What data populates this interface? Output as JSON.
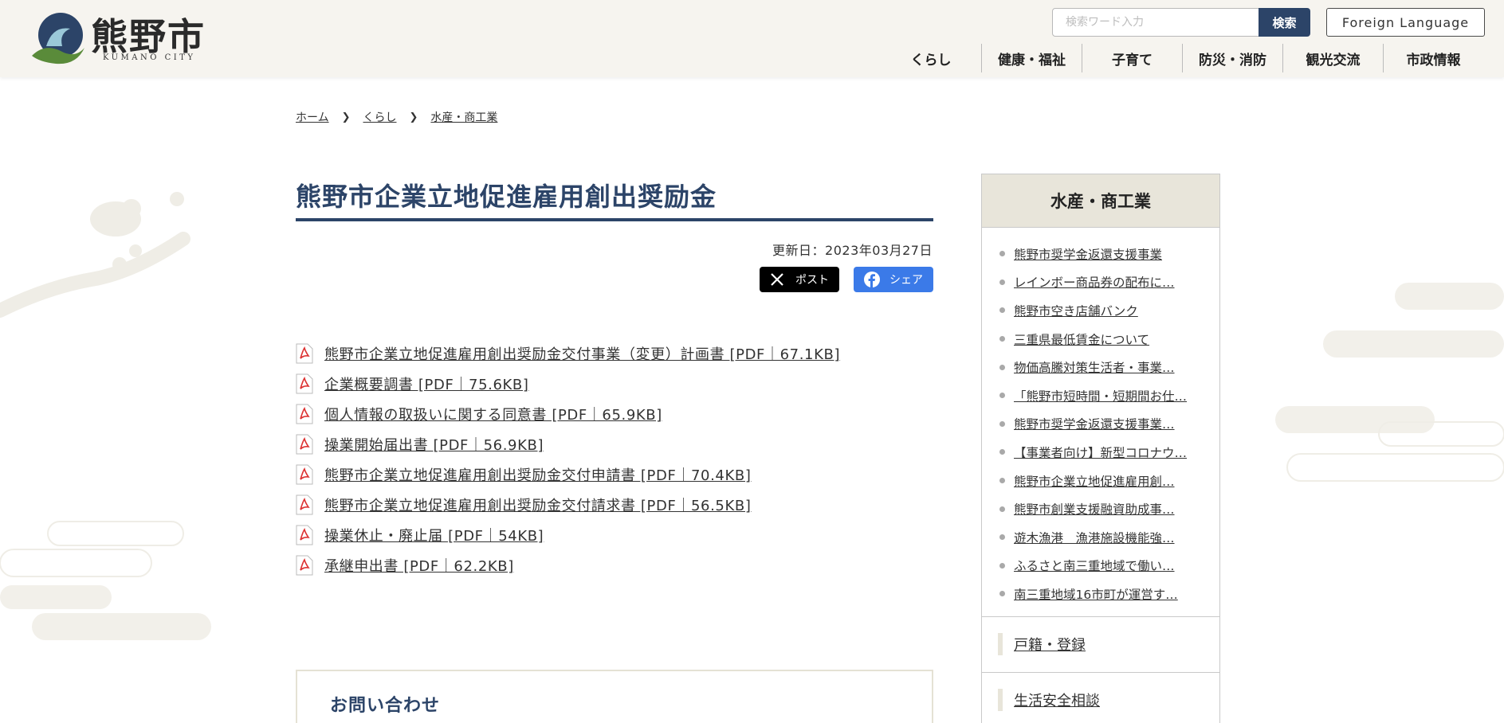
{
  "header": {
    "logo_text": "熊野市",
    "logo_sub": "KUMANO CITY",
    "search_placeholder": "検索ワード入力",
    "search_button": "検索",
    "foreign_button": "Foreign Language",
    "nav": [
      "くらし",
      "健康・福祉",
      "子育て",
      "防災・消防",
      "観光交流",
      "市政情報"
    ]
  },
  "breadcrumb": [
    "ホーム",
    "くらし",
    "水産・商工業"
  ],
  "main": {
    "title": "熊野市企業立地促進雇用創出奨励金",
    "updated": "更新日：2023年03月27日",
    "x_label": "ポスト",
    "fb_label": "シェア",
    "files": [
      "熊野市企業立地促進雇用創出奨励金交付事業（変更）計画書 [PDF｜67.1KB]",
      "企業概要調書 [PDF｜75.6KB]",
      "個人情報の取扱いに関する同意書 [PDF｜65.9KB]",
      "操業開始届出書 [PDF｜56.9KB]",
      "熊野市企業立地促進雇用創出奨励金交付申請書 [PDF｜70.4KB]",
      "熊野市企業立地促進雇用創出奨励金交付請求書 [PDF｜56.5KB]",
      "操業休止・廃止届 [PDF｜54KB]",
      "承継申出書 [PDF｜62.2KB]"
    ],
    "contact_title": "お問い合わせ"
  },
  "sidebar": {
    "title": "水産・商工業",
    "items": [
      "熊野市奨学金返還支援事業",
      "レインボー商品券の配布に…",
      "熊野市空き店舗バンク",
      "三重県最低賃金について",
      "物価高騰対策生活者・事業…",
      "「熊野市短時間・短期間お仕…",
      "熊野市奨学金返還支援事業…",
      "【事業者向け】新型コロナウ…",
      "熊野市企業立地促進雇用創…",
      "熊野市創業支援融資助成事…",
      "遊木漁港　漁港施設機能強…",
      "ふるさと南三重地域で働い…",
      "南三重地域16市町が運営す…"
    ],
    "categories": [
      "戸籍・登録",
      "生活安全相談"
    ]
  },
  "colors": {
    "accent": "#2c4468",
    "header_bg": "#f6f4ef",
    "sidebar_head_bg": "#e8e5da",
    "facebook": "#3b7ae8"
  }
}
